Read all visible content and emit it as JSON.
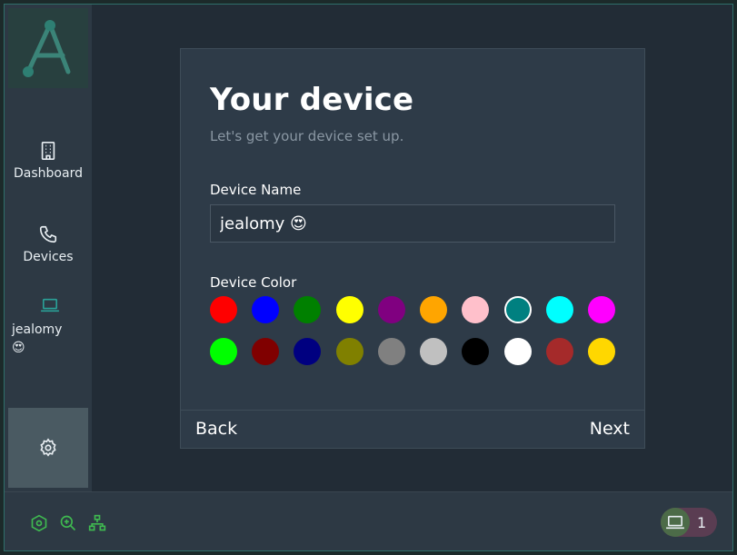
{
  "sidebar": {
    "logo_icon": "app-logo-a",
    "items": [
      {
        "label": "Dashboard",
        "icon": "building-icon"
      },
      {
        "label": "Devices",
        "icon": "phone-icon"
      }
    ],
    "current_device": {
      "name": "jealomy",
      "emoji": "😍",
      "icon": "laptop-icon"
    },
    "settings_icon": "gear-icon"
  },
  "card": {
    "title": "Your device",
    "subtitle": "Let's get your device set up.",
    "name_label": "Device Name",
    "name_value": "jealomy 😍",
    "color_label": "Device Color",
    "colors": [
      [
        "#ff0000",
        "#0000ff",
        "#008000",
        "#ffff00",
        "#800080",
        "#ffa500",
        "#ffc0cb",
        "#008080",
        "#00ffff",
        "#ff00ff"
      ],
      [
        "#00ff00",
        "#800000",
        "#000080",
        "#808000",
        "#808080",
        "#c0c0c0",
        "#000000",
        "#ffffff",
        "#a52a2a",
        "#ffd700"
      ]
    ],
    "selected_color": "#008080",
    "back_label": "Back",
    "next_label": "Next"
  },
  "bottombar": {
    "icons": [
      "hexagon-icon",
      "zoom-in-icon",
      "network-icon"
    ],
    "device_count": "1"
  },
  "accent_color": "#3fb950"
}
